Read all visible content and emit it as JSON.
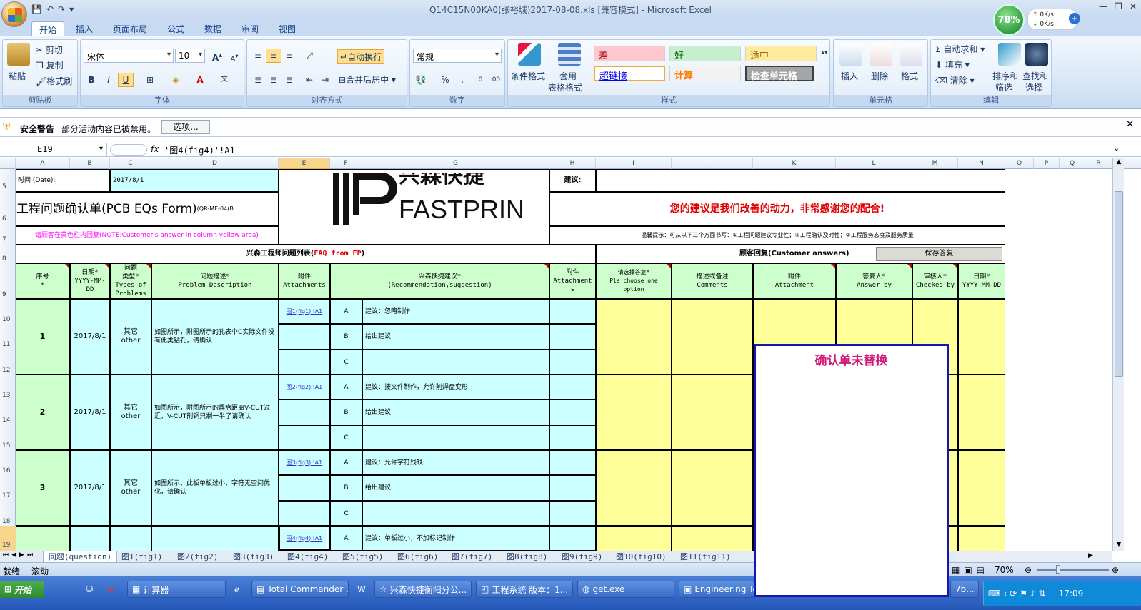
{
  "window": {
    "title": "Q14C15N00KA0(张裕城)2017-08-08.xls  [兼容模式] - Microsoft Excel",
    "net_percent": "78%",
    "up_rate": "0K/s",
    "down_rate": "0K/s"
  },
  "tabs": [
    "开始",
    "插入",
    "页面布局",
    "公式",
    "数据",
    "审阅",
    "视图"
  ],
  "ribbon": {
    "clipboard": {
      "paste": "粘贴",
      "cut": "剪切",
      "copy": "复制",
      "format_painter": "格式刷",
      "label": "剪贴板"
    },
    "font": {
      "name": "宋体",
      "size": "10",
      "label": "字体"
    },
    "alignment": {
      "wrap": "自动换行",
      "merge": "合并后居中",
      "label": "对齐方式"
    },
    "number": {
      "format": "常规",
      "label": "数字"
    },
    "styles": {
      "cond_format": "条件格式",
      "table_format": "套用",
      "table_format2": "表格格式",
      "bad": "差",
      "good": "好",
      "neutral": "适中",
      "hyperlink": "超链接",
      "calc": "计算",
      "check": "检查单元格",
      "label": "样式"
    },
    "cells": {
      "insert": "插入",
      "delete": "删除",
      "format": "格式",
      "label": "单元格"
    },
    "editing": {
      "autosum": "自动求和",
      "fill": "填充",
      "clear": "清除",
      "sort": "排序和",
      "sort2": "筛选",
      "find": "查找和",
      "find2": "选择",
      "label": "编辑"
    }
  },
  "security": {
    "title": "安全警告",
    "message": "部分活动内容已被禁用。",
    "options": "选项..."
  },
  "formula_bar": {
    "name_box": "E19",
    "fx": "fx",
    "formula": "'图4(fig4)'!A1"
  },
  "columns": [
    "A",
    "B",
    "C",
    "D",
    "E",
    "F",
    "G",
    "H",
    "I",
    "J",
    "K",
    "L",
    "M",
    "N",
    "O",
    "P",
    "Q",
    "R"
  ],
  "rows": [
    "5",
    "6",
    "7",
    "8",
    "9",
    "10",
    "11",
    "12",
    "13",
    "14",
    "15",
    "16",
    "17",
    "18",
    "19"
  ],
  "sheet": {
    "date_label": "时间 (Date):",
    "date_value": "2017/8/1",
    "suggest_label": "建议:",
    "title": "工程问题确认单(PCB EQs Form)",
    "title_code": "(QR-ME-04(B",
    "logo_cn": "兴森快捷",
    "logo_en": "FASTPRINT",
    "slogan": "您的建议是我们改善的动力，非常感谢您的配合!",
    "reply_note": "请顾客在黄色栏内回复(NOTE:Customer's answer in column yellow area)",
    "tips": "温馨提示：可从以下三个方面书写：①工程问题建议专业性；②工程确认及时性；③工程服务态度及服务质量",
    "faq_header": "兴森工程师问题列表(",
    "faq_header_red": "FAQ from FP",
    "faq_header_end": ")",
    "customer_header": "顾客回复(Customer answers)",
    "save_button": "保存答复",
    "headers": {
      "seq": "序号\n*",
      "date": "日期*\nYYYY-MM-DD",
      "type": "问题\n类型*\nTypes of\nProblems",
      "desc": "问题描述*\nProblem Description",
      "attach": "附件\nAttachments",
      "recommend": "兴森快捷建议*\n(Recommendation,suggestion)",
      "attach2": "附件\nAttachment\ns",
      "choose": "请选择答复*\nPls choose one\noption",
      "comments": "描述或备注\nComments",
      "attach3": "附件\nAttachment",
      "answer_by": "答复人*\nAnswer by",
      "checked_by": "审核人*\nChecked by",
      "date2": "日期*\nYYYY-MM-DD"
    },
    "records": [
      {
        "seq": "1",
        "date": "2017/8/1",
        "type": "其它\nother",
        "desc": "如图所示，附图所示的孔表中C实际文件没有此类钻孔，请确认",
        "link": "图1(fig1)'!A1",
        "options": [
          [
            "A",
            "建议：忽略制作"
          ],
          [
            "B",
            "给出建议"
          ],
          [
            "C",
            ""
          ]
        ]
      },
      {
        "seq": "2",
        "date": "2017/8/1",
        "type": "其它\nother",
        "desc": "如图所示，附图所示的焊盘距离V-CUT过近，V-CUT削铜只剩一半了请确认",
        "link": "图2(fig2)'!A1",
        "options": [
          [
            "A",
            "建议：按文件制作，允许削焊盘变形"
          ],
          [
            "B",
            "给出建议"
          ],
          [
            "C",
            ""
          ]
        ]
      },
      {
        "seq": "3",
        "date": "2017/8/1",
        "type": "其它\nother",
        "desc": "如图所示，此板单板过小，字符无空间优化，请确认",
        "link": "图3(fig3)'!A1",
        "options": [
          [
            "A",
            "建议：允许字符残缺"
          ],
          [
            "B",
            "给出建议"
          ],
          [
            "C",
            ""
          ]
        ]
      },
      {
        "seq": "",
        "date": "",
        "type": "",
        "desc": "",
        "link": "图4(fig4)'!A1",
        "options": [
          [
            "A",
            "建议：单板过小，不加标记制作"
          ]
        ]
      }
    ]
  },
  "popup": {
    "text": "确认单未替换"
  },
  "sheet_tabs": [
    "问题(question)",
    "图1(fig1)",
    "图2(fig2)",
    "图3(fig3)",
    "图4(fig4)",
    "图5(fig5)",
    "图6(fig6)",
    "图7(fig7)",
    "图8(fig8)",
    "图9(fig9)",
    "图10(fig10)",
    "图11(fig11)"
  ],
  "status": {
    "ready": "就绪",
    "scroll": "滚动",
    "zoom": "70%"
  },
  "taskbar": {
    "start": "开始",
    "items": [
      "计算器",
      "Total Commander 7....",
      "兴森快捷衡阳分公...",
      "工程系统 版本：1...",
      "get.exe",
      "Engineering Toolki",
      "7b..."
    ],
    "clock": "17:09"
  }
}
